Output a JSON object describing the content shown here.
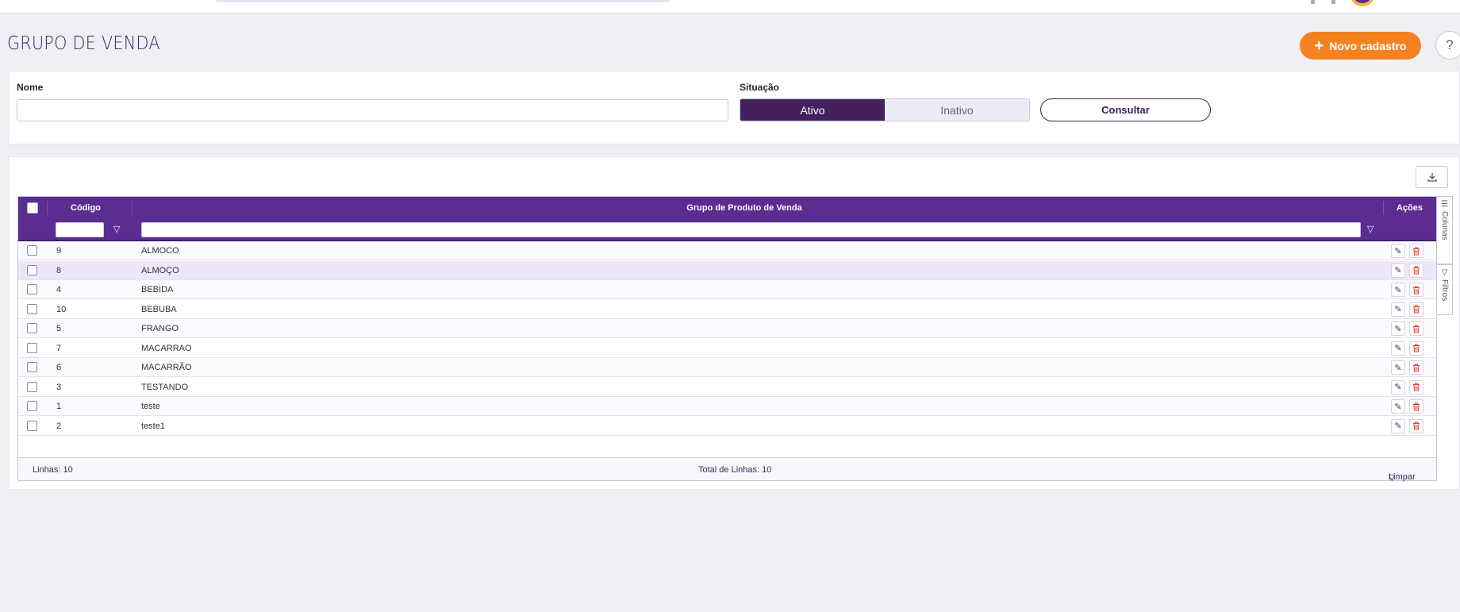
{
  "page": {
    "title": "GRUPO DE VENDA"
  },
  "header": {
    "new_label": "Novo cadastro",
    "new_icon": "plus-icon",
    "help_label": "?"
  },
  "filters": {
    "name_label": "Nome",
    "name_value": "",
    "situation_label": "Situação",
    "situation_options": [
      "Ativo",
      "Inativo"
    ],
    "situation_selected": "Ativo",
    "consult_label": "Consultar"
  },
  "grid": {
    "columns": {
      "code": "Código",
      "name": "Grupo de Produto de Venda",
      "actions": "Ações"
    },
    "rows": [
      {
        "code": "9",
        "name": "ALMOCO"
      },
      {
        "code": "8",
        "name": "ALMOÇO"
      },
      {
        "code": "4",
        "name": "BEBIDA"
      },
      {
        "code": "10",
        "name": "BEBUBA"
      },
      {
        "code": "5",
        "name": "FRANGO"
      },
      {
        "code": "7",
        "name": "MACARRAO"
      },
      {
        "code": "6",
        "name": "MACARRÃO"
      },
      {
        "code": "3",
        "name": "TESTANDO"
      },
      {
        "code": "1",
        "name": "teste"
      },
      {
        "code": "2",
        "name": "teste1"
      }
    ],
    "selected_row_code": "8",
    "footer": {
      "rows_label": "Linhas: 10",
      "total_label": "Total de Linhas: 10",
      "clear_label": "Limpar"
    },
    "side_tabs": {
      "columns": "Colunas",
      "filters": "Filtros"
    }
  },
  "colors": {
    "brand_purple": "#5c2d91",
    "dark_purple": "#44205f",
    "accent_orange": "#f58220",
    "delete_red": "#e23a3a"
  }
}
